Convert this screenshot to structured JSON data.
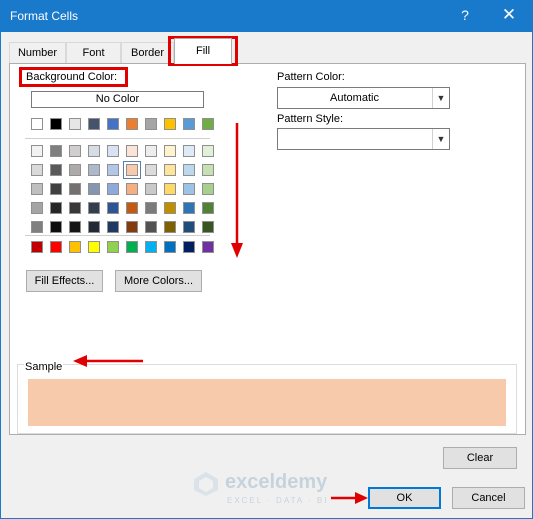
{
  "window": {
    "title": "Format Cells",
    "help_symbol": "?",
    "close_symbol": "✕",
    "title_bar_color": "#1979ca"
  },
  "tabs": [
    {
      "label": "Number",
      "active": false
    },
    {
      "label": "Font",
      "active": false
    },
    {
      "label": "Border",
      "active": false
    },
    {
      "label": "Fill",
      "active": true
    }
  ],
  "fill": {
    "background_color_label": "Background Color:",
    "no_color_label": "No Color",
    "palette": {
      "theme_top_row": [
        "#ffffff",
        "#000000",
        "#e7e6e6",
        "#44546a",
        "#4472c4",
        "#ed7d31",
        "#a5a5a5",
        "#ffc000",
        "#5b9bd5",
        "#70ad47"
      ],
      "theme_shades": [
        [
          "#f2f2f2",
          "#7f7f7f",
          "#d0cece",
          "#d6dce4",
          "#d9e2f3",
          "#fbe4d5",
          "#ededed",
          "#fff2cc",
          "#deebf6",
          "#e2efd9"
        ],
        [
          "#d9d9d9",
          "#595959",
          "#aeaaaa",
          "#adb9ca",
          "#b4c6e7",
          "#f7caac",
          "#dbdbdb",
          "#fee599",
          "#bdd7ee",
          "#c5e0b3"
        ],
        [
          "#bfbfbf",
          "#404040",
          "#757070",
          "#8496b0",
          "#8eaadb",
          "#f4b083",
          "#c9c9c9",
          "#ffd965",
          "#9cc3e5",
          "#a8d08d"
        ],
        [
          "#a5a5a5",
          "#262626",
          "#3a3838",
          "#333f4f",
          "#2f5496",
          "#c45911",
          "#7b7b7b",
          "#bf8f00",
          "#2e75b5",
          "#538135"
        ],
        [
          "#7f7f7f",
          "#0d0d0d",
          "#171616",
          "#222a35",
          "#1f3864",
          "#833c0b",
          "#525252",
          "#7f6000",
          "#1e4e79",
          "#375623"
        ]
      ],
      "standard_colors": [
        "#c00000",
        "#ff0000",
        "#ffc000",
        "#ffff00",
        "#92d050",
        "#00b050",
        "#00b0f0",
        "#0070c0",
        "#002060",
        "#7030a0"
      ],
      "selected_color": "#f7caac"
    },
    "fill_effects_label": "Fill Effects...",
    "more_colors_label": "More Colors...",
    "pattern_color_label": "Pattern Color:",
    "pattern_color_value": "Automatic",
    "pattern_style_label": "Pattern Style:",
    "pattern_style_value": "",
    "sample_label": "Sample",
    "sample_color": "#f7caac",
    "clear_label": "Clear"
  },
  "footer": {
    "ok_label": "OK",
    "cancel_label": "Cancel"
  },
  "annotations": {
    "color": "#e00000"
  },
  "watermark": {
    "name": "exceldemy",
    "subtitle": "EXCEL · DATA · BI"
  }
}
